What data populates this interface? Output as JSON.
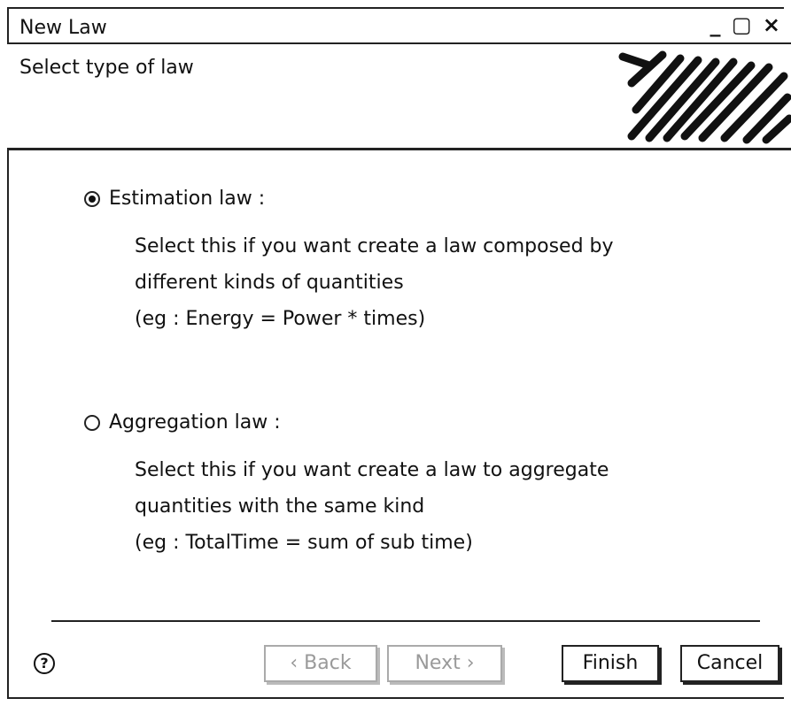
{
  "window": {
    "title": "New Law",
    "controls": "_ ▢ ×"
  },
  "header": {
    "title": "Select type of law"
  },
  "options": [
    {
      "label": "Estimation law :",
      "selected": true,
      "description": [
        "Select this if you want create a law composed by",
        "different kinds of quantities",
        "(eg : Energy = Power * times)"
      ]
    },
    {
      "label": "Aggregation law :",
      "selected": false,
      "description": [
        "Select this if you want create a law to aggregate",
        "quantities with the same kind",
        "(eg : TotalTime = sum of sub time)"
      ]
    }
  ],
  "footer": {
    "help_icon": "question-circle-icon",
    "help_label": "?",
    "back_label": "‹ Back",
    "next_label": "Next ›",
    "finish_label": "Finish",
    "cancel_label": "Cancel"
  }
}
